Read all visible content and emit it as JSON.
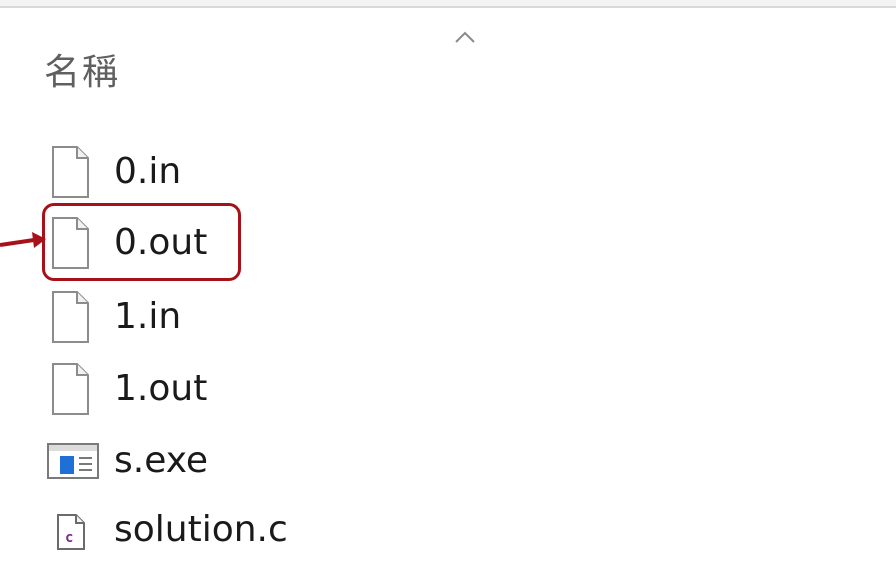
{
  "header": {
    "column_name": "名稱",
    "sort_icon": "chevron-up-icon"
  },
  "files": [
    {
      "name": "0.in",
      "icon": "blank-file-icon"
    },
    {
      "name": "0.out",
      "icon": "blank-file-icon",
      "highlighted": true
    },
    {
      "name": "1.in",
      "icon": "blank-file-icon"
    },
    {
      "name": "1.out",
      "icon": "blank-file-icon"
    },
    {
      "name": "s.exe",
      "icon": "executable-icon"
    },
    {
      "name": "solution.c",
      "icon": "c-source-file-icon"
    }
  ],
  "colors": {
    "highlight": "#a7111a",
    "text": "#1a1a1a",
    "header_text": "#606060",
    "exe_blue": "#1e6fd6",
    "c_file_purple": "#7a2a8c"
  }
}
